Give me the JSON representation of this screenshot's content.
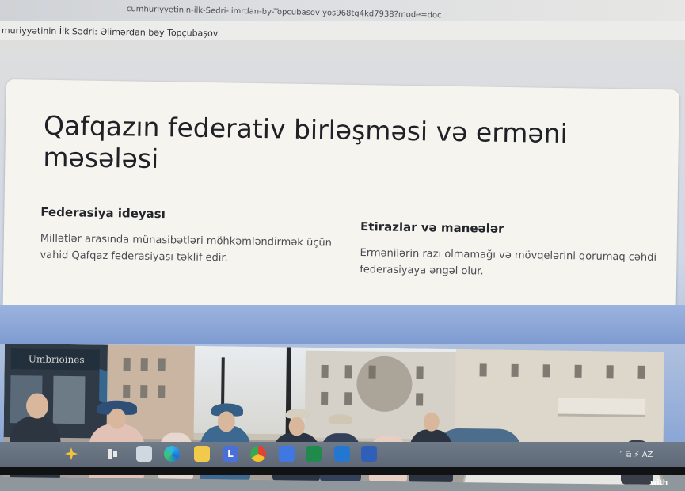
{
  "browser": {
    "url_text": "cumhuriyyetinin-ilk-Sedri-limrdan-by-Topcubasov-yos968tg4kd7938?mode=doc"
  },
  "document": {
    "title": "muriyyətinin İlk Sədri: Əlimərdan bəy Topçubaşov"
  },
  "slide": {
    "heading": "Qafqazın federativ birləşməsi və erməni məsələsi",
    "columns": [
      {
        "title": "Federasiya ideyası",
        "body": "Millətlər arasında münasibətləri möhkəmləndirmək üçün vahid Qafqaz federasiyası təklif edir."
      },
      {
        "title": "Etirazlar və maneələr",
        "body": "Ermənilərin razı olmamağı və mövqelərini qorumaq cəhdi federasiyaya əngəl olur."
      }
    ],
    "image": {
      "sign_text": "Umbrioines"
    }
  },
  "badge": {
    "made_with": "Made with"
  },
  "taskbar": {
    "icons": [
      "widgets-icon",
      "taskview-icon",
      "files-icon",
      "edge-icon",
      "explorer-icon",
      "l-app-icon",
      "chrome-icon",
      "store-icon",
      "excel-icon",
      "outlook-icon",
      "word-icon"
    ],
    "tray_text": "˄ ⧉ ⚡ AZ"
  }
}
